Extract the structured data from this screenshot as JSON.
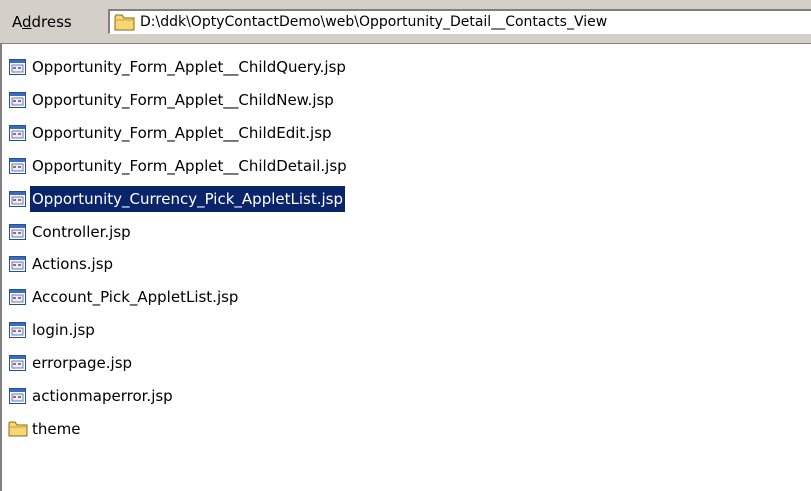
{
  "address_bar": {
    "label_accel": "A",
    "label_underlined": "d",
    "label_rest": "dress",
    "path": "D:\\ddk\\OptyContactDemo\\web\\Opportunity_Detail__Contacts_View",
    "folder_icon": "folder-icon"
  },
  "files": [
    {
      "name": "Opportunity_Form_Applet__ChildQuery.jsp",
      "icon": "jsp-file-icon",
      "selected": false
    },
    {
      "name": "Opportunity_Form_Applet__ChildNew.jsp",
      "icon": "jsp-file-icon",
      "selected": false
    },
    {
      "name": "Opportunity_Form_Applet__ChildEdit.jsp",
      "icon": "jsp-file-icon",
      "selected": false
    },
    {
      "name": "Opportunity_Form_Applet__ChildDetail.jsp",
      "icon": "jsp-file-icon",
      "selected": false
    },
    {
      "name": "Opportunity_Currency_Pick_AppletList.jsp",
      "icon": "jsp-file-icon",
      "selected": true
    },
    {
      "name": "Controller.jsp",
      "icon": "jsp-file-icon",
      "selected": false
    },
    {
      "name": "Actions.jsp",
      "icon": "jsp-file-icon",
      "selected": false
    },
    {
      "name": "Account_Pick_AppletList.jsp",
      "icon": "jsp-file-icon",
      "selected": false
    },
    {
      "name": "login.jsp",
      "icon": "jsp-file-icon",
      "selected": false
    },
    {
      "name": "errorpage.jsp",
      "icon": "jsp-file-icon",
      "selected": false
    },
    {
      "name": "actionmaperror.jsp",
      "icon": "jsp-file-icon",
      "selected": false
    },
    {
      "name": "theme",
      "icon": "folder-icon",
      "selected": false
    }
  ],
  "colors": {
    "toolbar_bg": "#d4d0c8",
    "selection_bg": "#0a246a",
    "selection_text": "#ffffff"
  }
}
